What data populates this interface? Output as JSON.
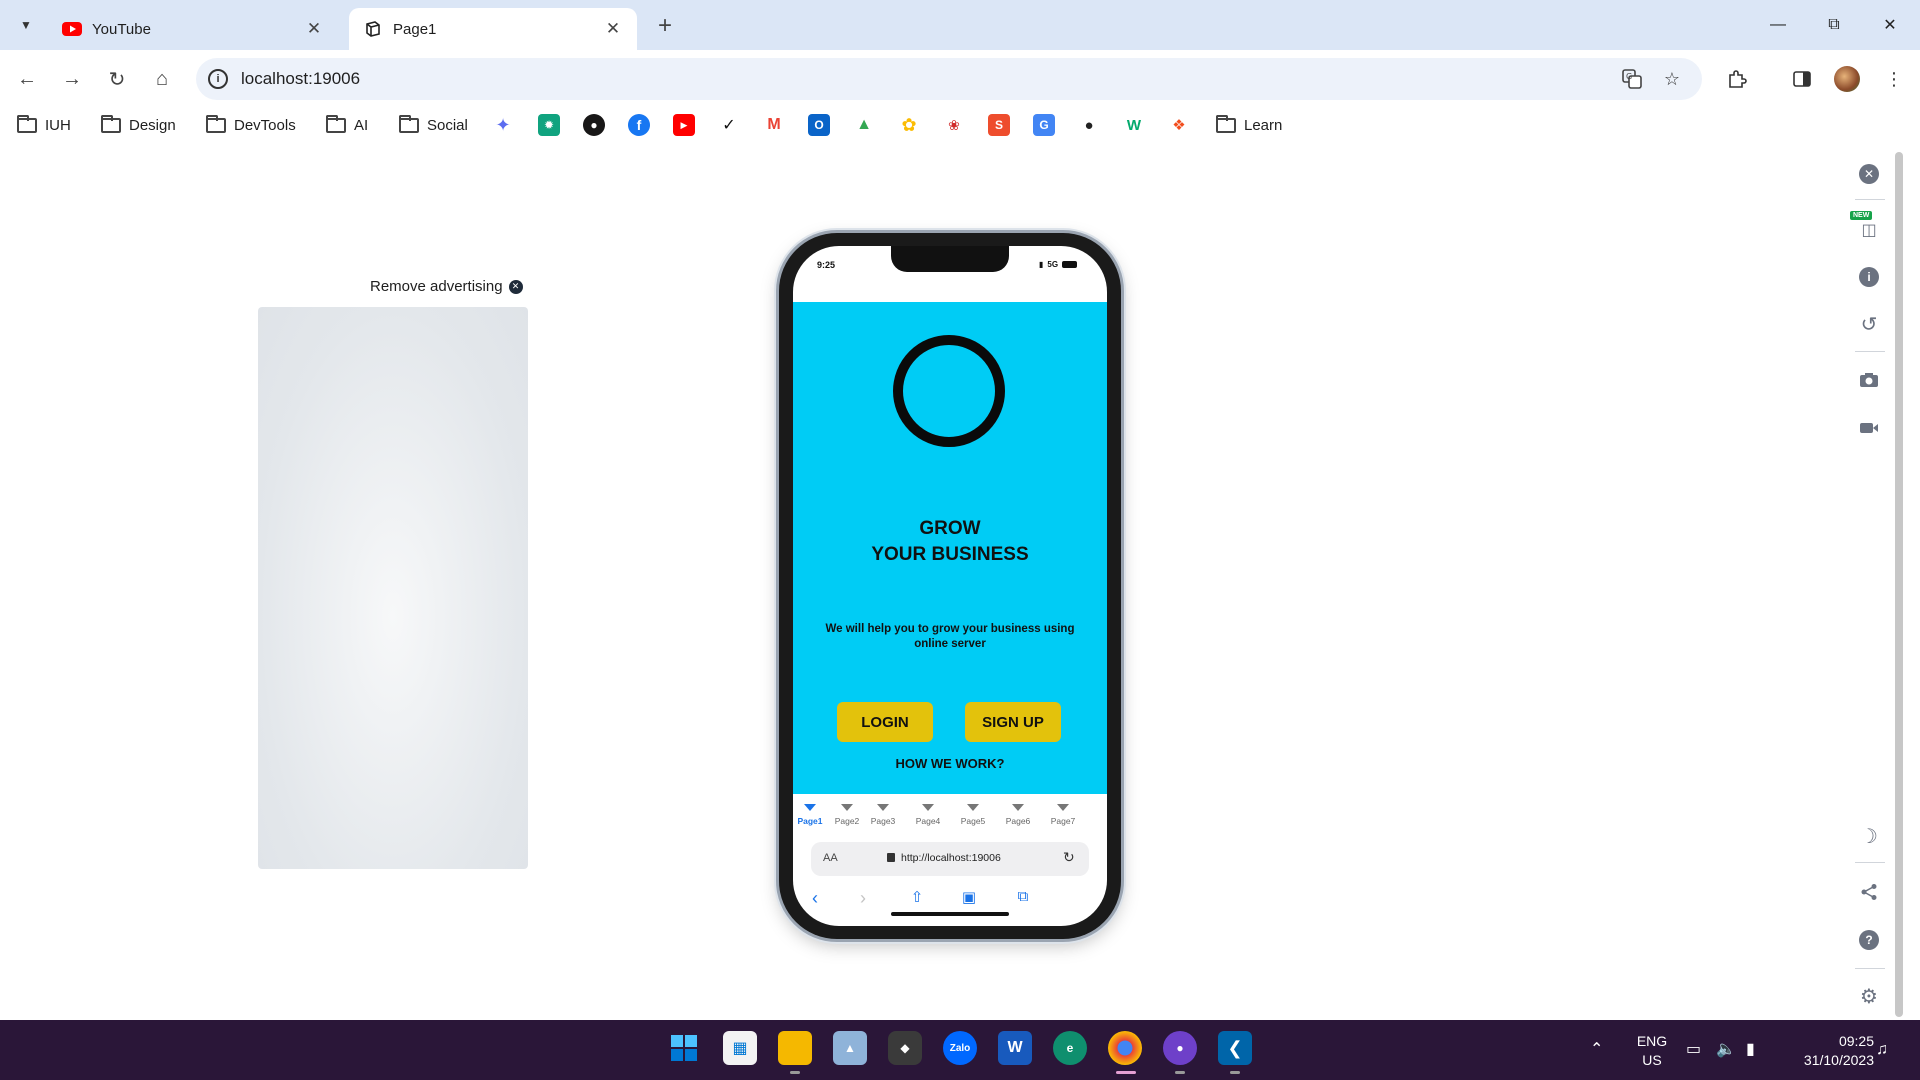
{
  "browser": {
    "tabs": [
      {
        "label": "YouTube",
        "favicon": "youtube-icon",
        "active": false
      },
      {
        "label": "Page1",
        "favicon": "responsive-viewer-icon",
        "active": true
      }
    ],
    "address": "localhost:19006",
    "bookmarks": [
      {
        "label": "IUH",
        "type": "folder"
      },
      {
        "label": "Design",
        "type": "folder"
      },
      {
        "label": "DevTools",
        "type": "folder"
      },
      {
        "label": "AI",
        "type": "folder"
      },
      {
        "label": "Social",
        "type": "folder"
      },
      {
        "label": "Learn",
        "type": "folder"
      }
    ],
    "bookmark_icons": [
      "gemini-icon",
      "chatgpt-icon",
      "github-icon",
      "facebook-icon",
      "youtube-icon",
      "nike-icon",
      "gmail-icon",
      "outlook-icon",
      "google-drive-icon",
      "google-photos-icon",
      "huawei-icon",
      "shopee-icon",
      "google-translate-icon",
      "linux-icon",
      "w3schools-icon",
      "figma-icon"
    ]
  },
  "ad": {
    "remove_label": "Remove advertising"
  },
  "phone": {
    "status_time": "9:25",
    "status_network": "5G",
    "headline_line1": "GROW",
    "headline_line2": "YOUR BUSINESS",
    "subtext": "We will help you to grow your business using online server",
    "login_label": "LOGIN",
    "signup_label": "SIGN UP",
    "how_label": "HOW WE WORK?",
    "page_tabs": [
      "Page1",
      "Page2",
      "Page3",
      "Page4",
      "Page5",
      "Page6",
      "Page7"
    ],
    "active_page_tab": "Page1",
    "safari_aa": "AA",
    "safari_url": "http://localhost:19006",
    "brand_color": "#00ccf5",
    "button_color": "#e3c20c"
  },
  "extension_rail": {
    "new_badge": "NEW"
  },
  "taskbar": {
    "lang_line1": "ENG",
    "lang_line2": "US",
    "time": "09:25",
    "date": "31/10/2023",
    "zalo_label": "Zalo"
  }
}
